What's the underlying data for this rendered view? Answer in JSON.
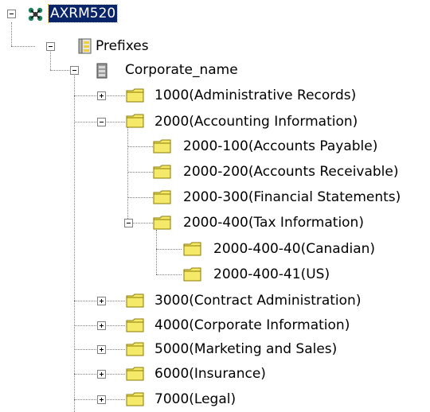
{
  "tree": {
    "colors": {
      "selection_bg": "#0a246a",
      "selection_text": "#ffffff",
      "folder_fill": "#f5e96a",
      "folder_outline": "#8a7a00",
      "guide_line": "#808080"
    },
    "root": {
      "label": "AXRM520",
      "icon": "network-server-icon",
      "expanded": true,
      "selected": true
    },
    "prefixes": {
      "label": "Prefixes",
      "icon": "prefixes-book-icon",
      "expanded": true
    },
    "corporate": {
      "label": "Corporate_name",
      "icon": "cabinet-icon",
      "expanded": true
    },
    "records": [
      {
        "label": "1000(Administrative Records)",
        "icon": "folder-icon",
        "expandable": true,
        "expanded": false
      },
      {
        "label": "2000(Accounting Information)",
        "icon": "folder-icon",
        "expandable": true,
        "expanded": true
      },
      {
        "label": "2000-100(Accounts Payable)",
        "icon": "folder-icon",
        "expandable": false
      },
      {
        "label": "2000-200(Accounts Receivable)",
        "icon": "folder-icon",
        "expandable": false
      },
      {
        "label": "2000-300(Financial Statements)",
        "icon": "folder-icon",
        "expandable": false
      },
      {
        "label": "2000-400(Tax Information)",
        "icon": "folder-icon",
        "expandable": true,
        "expanded": true
      },
      {
        "label": "2000-400-40(Canadian)",
        "icon": "folder-icon",
        "expandable": false
      },
      {
        "label": "2000-400-41(US)",
        "icon": "folder-icon",
        "expandable": false
      },
      {
        "label": "3000(Contract Administration)",
        "icon": "folder-icon",
        "expandable": true,
        "expanded": false
      },
      {
        "label": "4000(Corporate Information)",
        "icon": "folder-icon",
        "expandable": true,
        "expanded": false
      },
      {
        "label": "5000(Marketing and Sales)",
        "icon": "folder-icon",
        "expandable": true,
        "expanded": false
      },
      {
        "label": "6000(Insurance)",
        "icon": "folder-icon",
        "expandable": true,
        "expanded": false
      },
      {
        "label": "7000(Legal)",
        "icon": "folder-icon",
        "expandable": true,
        "expanded": false
      }
    ]
  }
}
